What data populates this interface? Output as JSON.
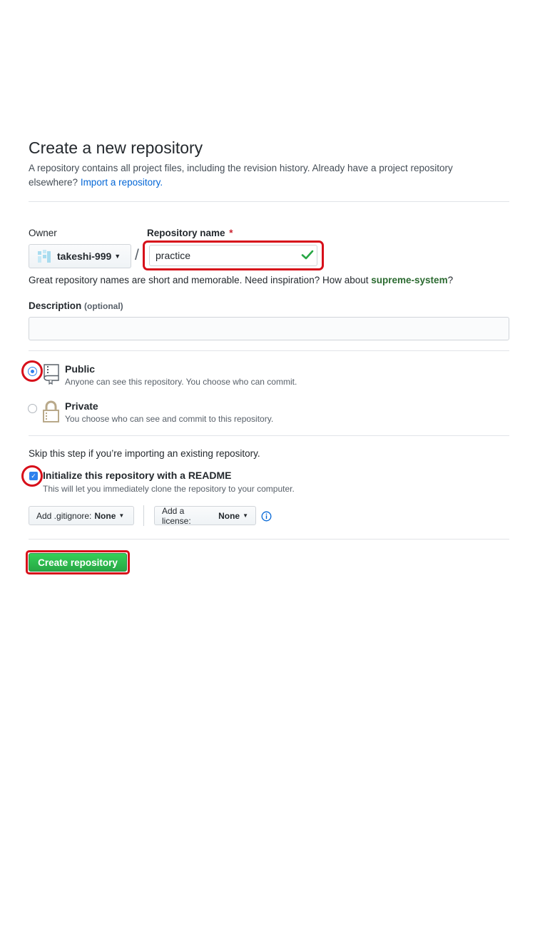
{
  "header": {
    "title": "Create a new repository",
    "intro_text": "A repository contains all project files, including the revision history. Already have a project repository elsewhere?",
    "import_link": "Import a repository."
  },
  "owner": {
    "label": "Owner",
    "selected": "takeshi-999"
  },
  "repo_name": {
    "label": "Repository name",
    "required_mark": "*",
    "value": "practice",
    "valid_icon": "check-icon"
  },
  "hint": {
    "text": "Great repository names are short and memorable. Need inspiration? How about",
    "suggestion": "supreme-system",
    "suffix": "?"
  },
  "description": {
    "label": "Description",
    "optional": "(optional)",
    "value": ""
  },
  "visibility": {
    "public": {
      "title": "Public",
      "note": "Anyone can see this repository. You choose who can commit.",
      "selected": true,
      "icon": "repo-book-icon"
    },
    "private": {
      "title": "Private",
      "note": "You choose who can see and commit to this repository.",
      "selected": false,
      "icon": "lock-icon"
    }
  },
  "readme": {
    "skip_text": "Skip this step if you’re importing an existing repository.",
    "title": "Initialize this repository with a README",
    "note": "This will let you immediately clone the repository to your computer.",
    "checked": true
  },
  "options": {
    "gitignore_label": "Add .gitignore:",
    "gitignore_value": "None",
    "license_label": "Add a license:",
    "license_value": "None",
    "info_icon": "info-icon"
  },
  "submit": {
    "label": "Create repository"
  },
  "colors": {
    "highlight": "#d70f1a",
    "primary_button": "#2ea44f",
    "link": "#0366d6",
    "accent_blue": "#2f80ed"
  }
}
